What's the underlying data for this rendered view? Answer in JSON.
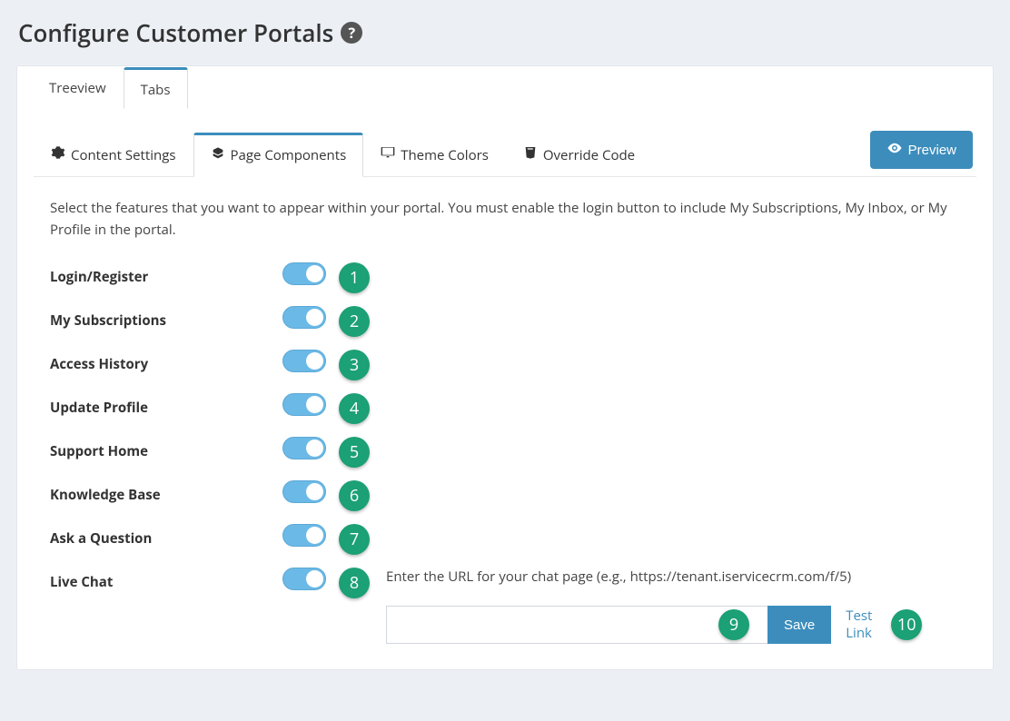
{
  "page": {
    "title": "Configure Customer Portals"
  },
  "outerTabs": [
    {
      "label": "Treeview"
    },
    {
      "label": "Tabs"
    }
  ],
  "innerTabs": [
    {
      "label": "Content Settings"
    },
    {
      "label": "Page Components"
    },
    {
      "label": "Theme Colors"
    },
    {
      "label": "Override Code"
    }
  ],
  "previewLabel": "Preview",
  "description": "Select the features that you want to appear within your portal. You must enable the login button to include My Subscriptions, My Inbox, or My Profile in the portal.",
  "components": [
    {
      "label": "Login/Register",
      "badge": "1"
    },
    {
      "label": "My Subscriptions",
      "badge": "2"
    },
    {
      "label": "Access History",
      "badge": "3"
    },
    {
      "label": "Update Profile",
      "badge": "4"
    },
    {
      "label": "Support Home",
      "badge": "5"
    },
    {
      "label": "Knowledge Base",
      "badge": "6"
    },
    {
      "label": "Ask a Question",
      "badge": "7"
    },
    {
      "label": "Live Chat",
      "badge": "8"
    }
  ],
  "chat": {
    "instruction": "Enter the URL for your chat page (e.g., https://tenant.iservicecrm.com/f/5)",
    "urlValue": "",
    "saveLabel": "Save",
    "testLinkLabel": "Test Link",
    "urlBadge": "9",
    "testBadge": "10"
  }
}
